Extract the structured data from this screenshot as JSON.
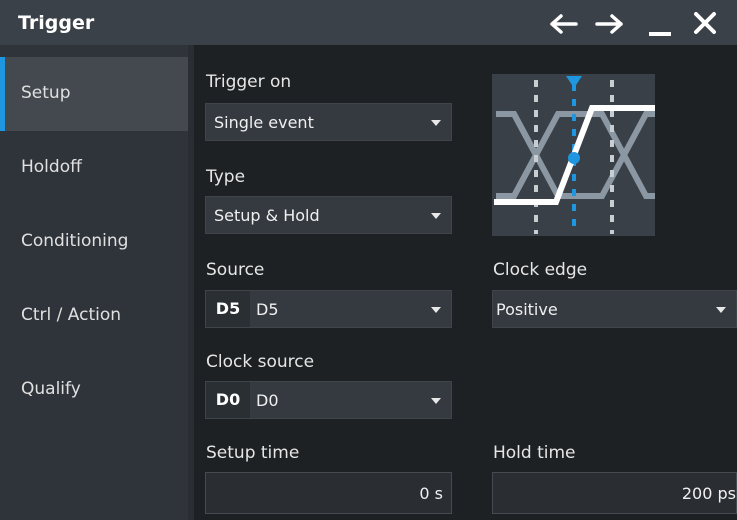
{
  "window": {
    "title": "Trigger",
    "buttons": [
      {
        "name": "back-arrow-icon",
        "glyph": "←"
      },
      {
        "name": "forward-arrow-icon",
        "glyph": "→"
      },
      {
        "name": "minimize-icon",
        "glyph": "—"
      },
      {
        "name": "close-icon",
        "glyph": "✕"
      }
    ]
  },
  "sidebar": {
    "items": [
      {
        "label": "Setup",
        "active": true
      },
      {
        "label": "Holdoff",
        "active": false
      },
      {
        "label": "Conditioning",
        "active": false
      },
      {
        "label": "Ctrl / Action",
        "active": false
      },
      {
        "label": "Qualify",
        "active": false
      }
    ]
  },
  "form": {
    "trigger_on": {
      "label": "Trigger on",
      "value": "Single event"
    },
    "type": {
      "label": "Type",
      "value": "Setup & Hold"
    },
    "source": {
      "label": "Source",
      "tag": "D5",
      "value": "D5"
    },
    "clock_edge": {
      "label": "Clock edge",
      "value": "Positive"
    },
    "clock_source": {
      "label": "Clock source",
      "tag": "D0",
      "value": "D0"
    },
    "setup_time": {
      "label": "Setup time",
      "value": "0 s"
    },
    "hold_time": {
      "label": "Hold time",
      "value": "200 ps"
    }
  },
  "colors": {
    "accent": "#1f96e0",
    "titlebar": "#3b4148",
    "sidebar": "#2f343a",
    "panel": "#1e2124"
  }
}
